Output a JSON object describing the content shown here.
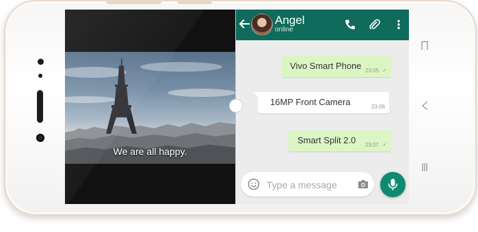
{
  "video": {
    "subtitle": "We are all happy."
  },
  "chat": {
    "contact": {
      "name": "Angel",
      "status": "online"
    },
    "header_icons": [
      "back-arrow-icon",
      "phone-icon",
      "paperclip-icon",
      "more-vert-icon"
    ],
    "messages": [
      {
        "direction": "outgoing",
        "text": "Vivo Smart Phone",
        "time": "23:05",
        "status": "✓"
      },
      {
        "direction": "incoming",
        "text": "16MP Front Camera",
        "time": "23:06"
      },
      {
        "direction": "outgoing",
        "text": "Smart Split 2.0",
        "time": "23:07",
        "status": "✓"
      }
    ],
    "composer": {
      "placeholder": "Type a message"
    }
  },
  "device": {
    "nav_icons": [
      "recent-apps-icon",
      "back-icon",
      "menu-icon"
    ]
  },
  "colors": {
    "header": "#0f6b5c",
    "outgoing_bubble": "#dcf5c4",
    "incoming_bubble": "#ffffff",
    "mic_button": "#0f8a72",
    "split_line": "#8fd0f0"
  }
}
